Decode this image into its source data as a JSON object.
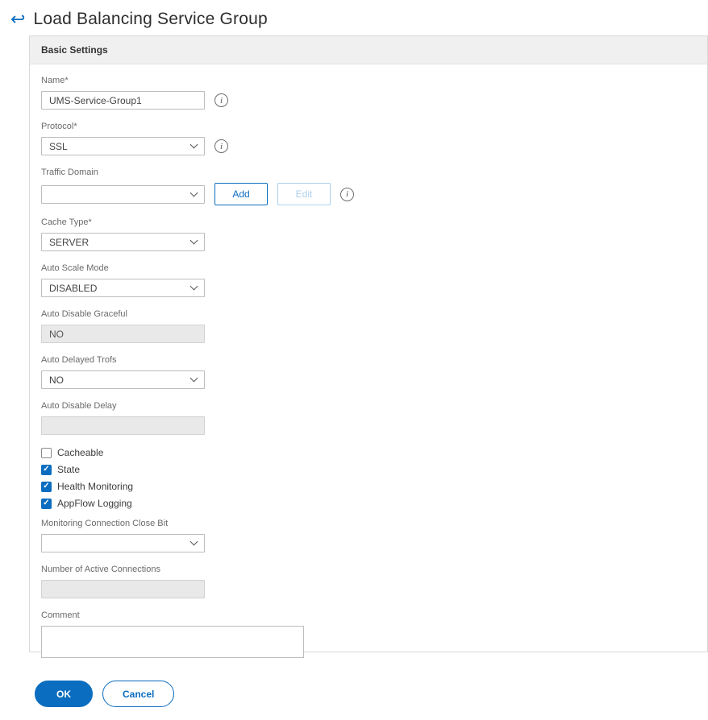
{
  "header": {
    "title": "Load Balancing Service Group"
  },
  "panel": {
    "title": "Basic Settings"
  },
  "icons": {
    "back": "↩",
    "info": "i",
    "check": "✓"
  },
  "colors": {
    "accent": "#0a6dbf"
  },
  "fields": {
    "name": {
      "label": "Name*",
      "value": "UMS-Service-Group1"
    },
    "protocol": {
      "label": "Protocol*",
      "value": "SSL"
    },
    "traffic_domain": {
      "label": "Traffic Domain",
      "value": "",
      "add_label": "Add",
      "edit_label": "Edit"
    },
    "cache_type": {
      "label": "Cache Type*",
      "value": "SERVER"
    },
    "auto_scale_mode": {
      "label": "Auto Scale Mode",
      "value": "DISABLED"
    },
    "auto_disable_graceful": {
      "label": "Auto Disable Graceful",
      "value": "NO"
    },
    "auto_delayed_trofs": {
      "label": "Auto Delayed Trofs",
      "value": "NO"
    },
    "auto_disable_delay": {
      "label": "Auto Disable Delay",
      "value": ""
    },
    "monitoring_connection_close_bit": {
      "label": "Monitoring Connection Close Bit",
      "value": ""
    },
    "number_of_active_connections": {
      "label": "Number of Active Connections",
      "value": ""
    },
    "comment": {
      "label": "Comment",
      "value": ""
    }
  },
  "checkboxes": [
    {
      "label": "Cacheable",
      "checked": false
    },
    {
      "label": "State",
      "checked": true
    },
    {
      "label": "Health Monitoring",
      "checked": true
    },
    {
      "label": "AppFlow Logging",
      "checked": true
    }
  ],
  "footer": {
    "ok": "OK",
    "cancel": "Cancel"
  }
}
